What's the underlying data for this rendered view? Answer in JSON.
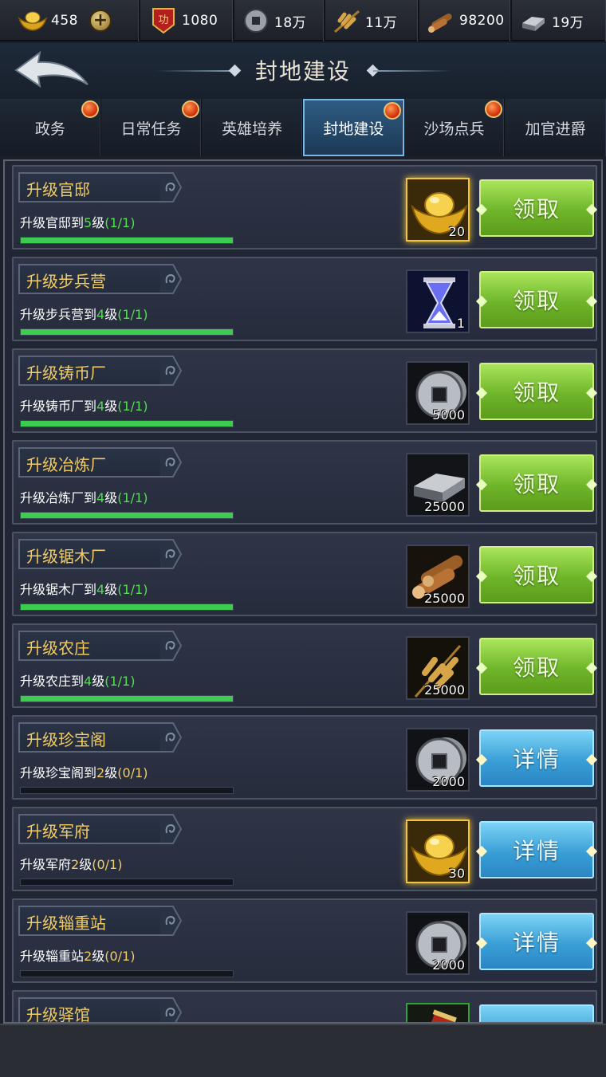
{
  "resources": [
    {
      "icon": "gold-ingot-icon",
      "value": "458"
    },
    {
      "icon": "merit-badge-icon",
      "value": "1080"
    },
    {
      "icon": "copper-coin-icon",
      "value": "18万"
    },
    {
      "icon": "grain-icon",
      "value": "11万"
    },
    {
      "icon": "wood-icon",
      "value": "98200"
    },
    {
      "icon": "iron-icon",
      "value": "19万"
    }
  ],
  "merit_badge_text": "功",
  "header": {
    "title": "封地建设"
  },
  "tabs": [
    {
      "label": "政务",
      "badge": true
    },
    {
      "label": "日常任务",
      "badge": true
    },
    {
      "label": "英雄培养",
      "badge": false
    },
    {
      "label": "封地建设",
      "badge": true,
      "active": true
    },
    {
      "label": "沙场点兵",
      "badge": true
    },
    {
      "label": "加官进爵",
      "badge": false
    }
  ],
  "tasks": [
    {
      "name": "升级官邸",
      "desc_prefix": "升级官邸到",
      "level": "5",
      "desc_suffix": "级",
      "progress_text": "(1/1)",
      "progress": 1,
      "reward_icon": "gold-ingot-icon",
      "reward_count": "20",
      "button": "领取"
    },
    {
      "name": "升级步兵营",
      "desc_prefix": "升级步兵营到",
      "level": "4",
      "desc_suffix": "级",
      "progress_text": "(1/1)",
      "progress": 1,
      "reward_icon": "hourglass-icon",
      "reward_count": "1",
      "button": "领取"
    },
    {
      "name": "升级铸币厂",
      "desc_prefix": "升级铸币厂到",
      "level": "4",
      "desc_suffix": "级",
      "progress_text": "(1/1)",
      "progress": 1,
      "reward_icon": "copper-coin-icon",
      "reward_count": "5000",
      "button": "领取"
    },
    {
      "name": "升级冶炼厂",
      "desc_prefix": "升级冶炼厂到",
      "level": "4",
      "desc_suffix": "级",
      "progress_text": "(1/1)",
      "progress": 1,
      "reward_icon": "iron-icon",
      "reward_count": "25000",
      "button": "领取"
    },
    {
      "name": "升级锯木厂",
      "desc_prefix": "升级锯木厂到",
      "level": "4",
      "desc_suffix": "级",
      "progress_text": "(1/1)",
      "progress": 1,
      "reward_icon": "wood-icon",
      "reward_count": "25000",
      "button": "领取"
    },
    {
      "name": "升级农庄",
      "desc_prefix": "升级农庄到",
      "level": "4",
      "desc_suffix": "级",
      "progress_text": "(1/1)",
      "progress": 1,
      "reward_icon": "grain-icon",
      "reward_count": "25000",
      "button": "领取"
    },
    {
      "name": "升级珍宝阁",
      "desc_prefix": "升级珍宝阁到",
      "level": "2",
      "desc_suffix": "级",
      "progress_text": "(0/1)",
      "progress": 0,
      "reward_icon": "copper-coin-icon",
      "reward_count": "2000",
      "button": "详情"
    },
    {
      "name": "升级军府",
      "desc_prefix": "升级军府",
      "level": "2",
      "desc_suffix": "级",
      "progress_text": "(0/1)",
      "progress": 0,
      "reward_icon": "gold-ingot-icon",
      "reward_count": "30",
      "button": "详情"
    },
    {
      "name": "升级辎重站",
      "desc_prefix": "升级辎重站",
      "level": "2",
      "desc_suffix": "级",
      "progress_text": "(0/1)",
      "progress": 0,
      "reward_icon": "copper-coin-icon",
      "reward_count": "2000",
      "button": "详情"
    },
    {
      "name": "升级驿馆",
      "desc_prefix": "",
      "level": "",
      "desc_suffix": "",
      "progress_text": "",
      "progress": 0,
      "reward_icon": "scroll-icon",
      "reward_count": "",
      "button": ""
    }
  ],
  "colors": {
    "accent_gold": "#f2cc64",
    "done_green": "#52e04e",
    "claim_green": "#6fb52a",
    "detail_blue": "#3a9fd6"
  }
}
